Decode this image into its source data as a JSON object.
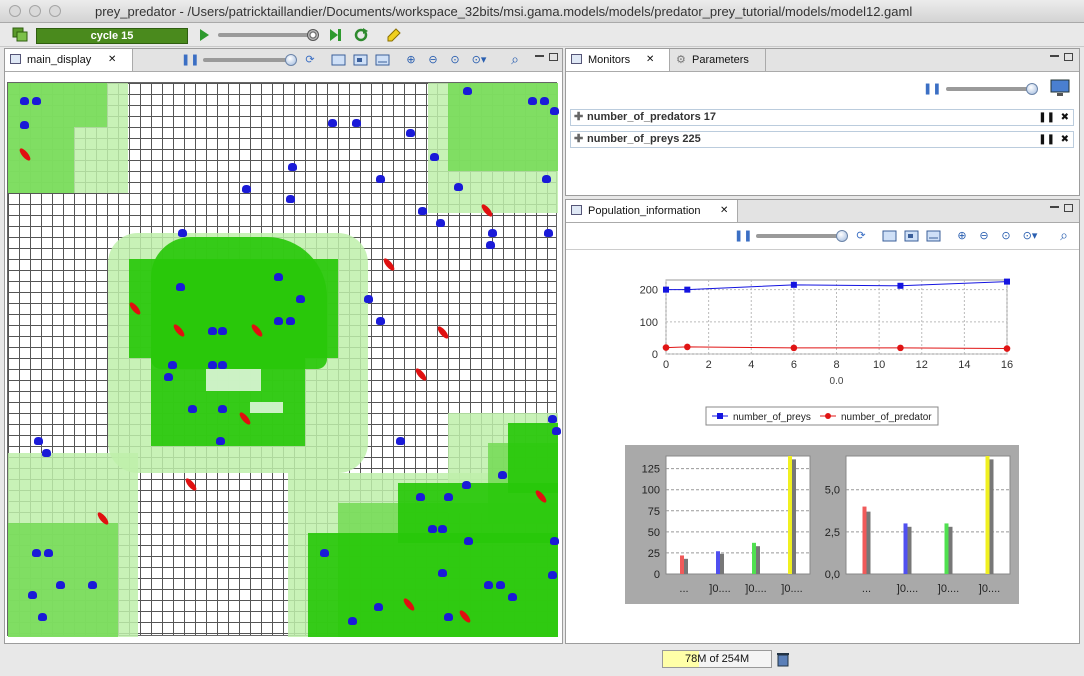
{
  "window": {
    "title": "prey_predator - /Users/patricktaillandier/Documents/workspace_32bits/msi.gama.models/models/predator_prey_tutorial/models/model12.gaml"
  },
  "toolbar": {
    "cycle_label": "cycle 15"
  },
  "display_panel": {
    "tab_label": "main_display"
  },
  "monitors_panel": {
    "tabs": [
      "Monitors",
      "Parameters"
    ],
    "monitors": [
      {
        "name": "number_of_predators",
        "value": "17"
      },
      {
        "name": "number_of_preys",
        "value": "225"
      }
    ]
  },
  "population_panel": {
    "tab_label": "Population_information"
  },
  "status": {
    "memory": "78M of 254M"
  },
  "colors": {
    "prey": "#1a1ad8",
    "predator": "#e01010",
    "grass_dark": "#28c80a",
    "cycle_bar": "#4a8a1d"
  },
  "chart_data": [
    {
      "type": "line",
      "title": "",
      "xlabel": "0.0",
      "ylabel": "",
      "x": [
        0,
        1,
        6,
        11,
        16
      ],
      "xticks": [
        "0",
        "2",
        "4",
        "6",
        "8",
        "10",
        "12",
        "14",
        "16"
      ],
      "yticks": [
        "0",
        "100",
        "200"
      ],
      "xlim": [
        0,
        16
      ],
      "ylim": [
        0,
        230
      ],
      "grid": true,
      "legend": "bottom",
      "series": [
        {
          "name": "number_of_preys",
          "color": "#1414e0",
          "values": [
            200,
            200,
            215,
            212,
            225
          ]
        },
        {
          "name": "number_of_predator",
          "color": "#e01414",
          "values": [
            20,
            22,
            19,
            19,
            17
          ]
        }
      ]
    },
    {
      "type": "bar",
      "categories": [
        "...",
        "]0....",
        "]0....",
        "]0...."
      ],
      "yticks": [
        "0",
        "25",
        "50",
        "75",
        "100",
        "125"
      ],
      "ylim": [
        0,
        140
      ],
      "grid": true,
      "series": [
        {
          "color": "#f05a5a",
          "values": [
            22,
            27,
            37,
            140
          ]
        },
        {
          "color": "#777777",
          "values": [
            18,
            24,
            33,
            136
          ]
        }
      ],
      "category_colors": [
        "#f05a5a",
        "#5050f0",
        "#50e050",
        "#f0f020"
      ]
    },
    {
      "type": "bar",
      "categories": [
        "...",
        "]0....",
        "]0....",
        "]0...."
      ],
      "yticks": [
        "0,0",
        "2,5",
        "5,0"
      ],
      "ylim": [
        0,
        7
      ],
      "grid": true,
      "series": [
        {
          "color": "#f05a5a",
          "values": [
            4.0,
            3.0,
            3.0,
            7.0
          ]
        },
        {
          "color": "#777777",
          "values": [
            3.7,
            2.8,
            2.8,
            6.8
          ]
        }
      ],
      "category_colors": [
        "#f05a5a",
        "#5050f0",
        "#50e050",
        "#f0f020"
      ]
    }
  ]
}
